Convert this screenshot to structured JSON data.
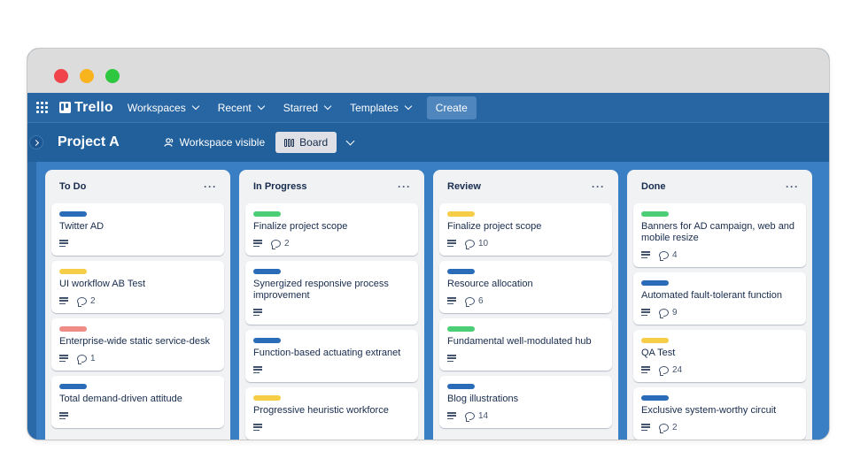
{
  "colors": {
    "green": "#4bce75",
    "blue": "#2b6cb8",
    "yellow": "#f5cd47",
    "red": "#f08c86"
  },
  "nav": {
    "logo": "Trello",
    "items": [
      "Workspaces",
      "Recent",
      "Starred",
      "Templates"
    ],
    "create": "Create"
  },
  "board": {
    "title": "Project A",
    "visibility": "Workspace visible",
    "view": "Board"
  },
  "lists": [
    {
      "title": "To Do",
      "menu": "···",
      "cards": [
        {
          "label": "blue",
          "title": "Twitter AD",
          "comments": ""
        },
        {
          "label": "yellow",
          "title": "UI workflow AB Test",
          "comments": "2"
        },
        {
          "label": "red",
          "title": "Enterprise-wide static service-desk",
          "comments": "1"
        },
        {
          "label": "blue",
          "title": "Total demand-driven attitude",
          "comments": ""
        }
      ]
    },
    {
      "title": "In Progress",
      "menu": "···",
      "cards": [
        {
          "label": "green",
          "title": "Finalize project scope",
          "comments": "2"
        },
        {
          "label": "blue",
          "title": "Synergized responsive process improvement",
          "comments": ""
        },
        {
          "label": "blue",
          "title": "Function-based actuating extranet",
          "comments": ""
        },
        {
          "label": "yellow",
          "title": "Progressive heuristic workforce",
          "comments": ""
        }
      ]
    },
    {
      "title": "Review",
      "menu": "···",
      "cards": [
        {
          "label": "yellow",
          "title": "Finalize project scope",
          "comments": "10"
        },
        {
          "label": "blue",
          "title": "Resource allocation",
          "comments": "6"
        },
        {
          "label": "green",
          "title": "Fundamental well-modulated hub",
          "comments": ""
        },
        {
          "label": "blue",
          "title": "Blog illustrations",
          "comments": "14"
        }
      ]
    },
    {
      "title": "Done",
      "menu": "···",
      "cards": [
        {
          "label": "green",
          "title": "Banners for AD campaign, web and mobile resize",
          "comments": "4"
        },
        {
          "label": "blue",
          "title": "Automated fault-tolerant function",
          "comments": "9"
        },
        {
          "label": "yellow",
          "title": "QA Test",
          "comments": "24"
        },
        {
          "label": "blue",
          "title": "Exclusive system-worthy circuit",
          "comments": "2"
        }
      ]
    }
  ]
}
